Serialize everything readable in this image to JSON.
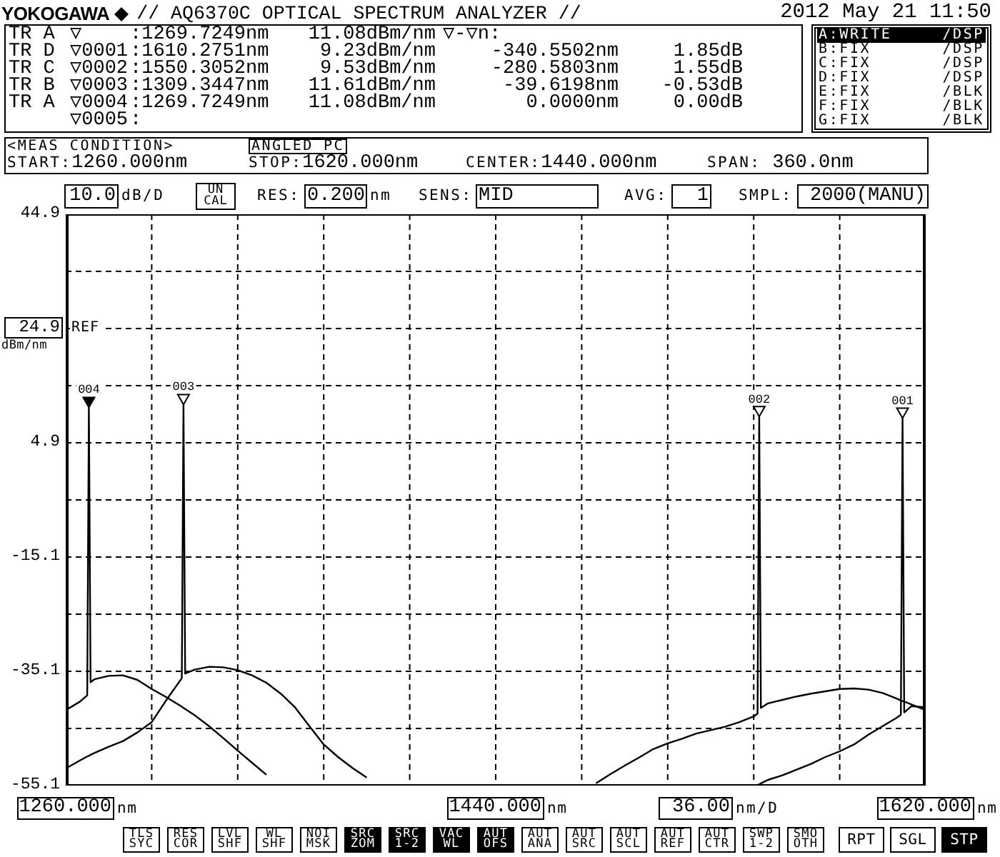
{
  "header": {
    "brand": "YOKOGAWA",
    "title": "// AQ6370C OPTICAL SPECTRUM ANALYZER //",
    "datetime": "2012 May 21 11:50"
  },
  "marker_table": {
    "active": {
      "trace": "TR A",
      "marker": "▽",
      "wavelength": ":1269.7249nm",
      "level": "11.08dBm/nm"
    },
    "delta_header": "▽-▽n:",
    "rows": [
      {
        "trace": "TR D",
        "marker": "▽0001",
        "wavelength": ":1610.2751nm",
        "level": "9.23dBm/nm",
        "delta_wavelength": "-340.5502nm",
        "delta_level": "1.85dB"
      },
      {
        "trace": "TR C",
        "marker": "▽0002",
        "wavelength": ":1550.3052nm",
        "level": "9.53dBm/nm",
        "delta_wavelength": "-280.5803nm",
        "delta_level": "1.55dB"
      },
      {
        "trace": "TR B",
        "marker": "▽0003",
        "wavelength": ":1309.3447nm",
        "level": "11.61dBm/nm",
        "delta_wavelength": "-39.6198nm",
        "delta_level": "-0.53dB"
      },
      {
        "trace": "TR A",
        "marker": "▽0004",
        "wavelength": ":1269.7249nm",
        "level": "11.08dBm/nm",
        "delta_wavelength": "0.0000nm",
        "delta_level": "0.00dB"
      },
      {
        "marker": "▽0005",
        "wavelength": ":"
      }
    ]
  },
  "traces": [
    {
      "label": "A:WRITE",
      "mode": "/DSP",
      "selected": true
    },
    {
      "label": "B:FIX",
      "mode": "/DSP",
      "selected": false
    },
    {
      "label": "C:FIX",
      "mode": "/DSP",
      "selected": false
    },
    {
      "label": "D:FIX",
      "mode": "/DSP",
      "selected": false
    },
    {
      "label": "E:FIX",
      "mode": "/BLK",
      "selected": false
    },
    {
      "label": "F:FIX",
      "mode": "/BLK",
      "selected": false
    },
    {
      "label": "G:FIX",
      "mode": "/BLK",
      "selected": false
    }
  ],
  "meas_condition": {
    "title": "<MEAS CONDITION>",
    "badge": "ANGLED PC",
    "fields": [
      {
        "label": "START:",
        "value": "1260.000nm"
      },
      {
        "label": "STOP:",
        "value": "1620.000nm"
      },
      {
        "label": "CENTER:",
        "value": "1440.000nm"
      },
      {
        "label": "SPAN:",
        "value": "360.0nm"
      }
    ]
  },
  "settings": [
    {
      "kind": "readout",
      "value": "10.0",
      "unit": "dB/D"
    },
    {
      "kind": "indicator",
      "lines": [
        "UN",
        "CAL"
      ]
    },
    {
      "kind": "readout",
      "label": "RES:",
      "value": "0.200",
      "unit": "nm"
    },
    {
      "kind": "select",
      "label": "SENS:",
      "value": "MID"
    },
    {
      "kind": "readout",
      "label": "AVG:",
      "value": "1"
    },
    {
      "kind": "readout",
      "label": "SMPL:",
      "value": "2000(MANU)"
    }
  ],
  "plot": {
    "ref": {
      "value": "24.9",
      "unit": "dBm/nm",
      "tag": "REF"
    },
    "markers": [
      {
        "label": "004",
        "selected": true
      },
      {
        "label": "003",
        "selected": false
      },
      {
        "label": "002",
        "selected": false
      },
      {
        "label": "001",
        "selected": false
      }
    ],
    "xtick_units": [
      "nm",
      "nm",
      "nm"
    ],
    "x_scale": {
      "value": "36.00",
      "unit": "nm/D"
    },
    "chart_data": {
      "type": "line",
      "grid": true,
      "xlim": [
        1260,
        1620
      ],
      "ylim": [
        -55.1,
        44.9
      ],
      "xticks": [
        {
          "value": 1260,
          "label": "1260.000"
        },
        {
          "value": 1440,
          "label": "1440.000"
        },
        {
          "value": 1620,
          "label": "1620.000"
        }
      ],
      "yticks": [
        {
          "value": 44.9,
          "label": "44.9"
        },
        {
          "value": 4.9,
          "label": "4.9"
        },
        {
          "value": -15.1,
          "label": "-15.1"
        },
        {
          "value": -35.1,
          "label": "-35.1"
        },
        {
          "value": -55.1,
          "label": "-55.1"
        }
      ],
      "x": [
        1260,
        1266,
        1269,
        1269.7,
        1270.4,
        1272,
        1278,
        1284,
        1290,
        1296,
        1302,
        1308.6,
        1309.3,
        1310,
        1314,
        1320,
        1326,
        1332,
        1338,
        1344,
        1350,
        1356,
        1362,
        1368,
        1374,
        1380,
        1386,
        1482,
        1488,
        1494,
        1500,
        1506,
        1512,
        1518,
        1524,
        1530,
        1536,
        1542,
        1548,
        1549.6,
        1550.3,
        1551,
        1554,
        1560,
        1566,
        1572,
        1578,
        1584,
        1590,
        1596,
        1602,
        1608,
        1609.6,
        1610.3,
        1611,
        1614,
        1620
      ],
      "series": [
        {
          "color": "#000000",
          "values": [
            -41.9,
            -40.4,
            -39.3,
            11.1,
            -37.0,
            -36.5,
            -35.9,
            -35.8,
            -36.6,
            -38.2,
            -39.6,
            -41.3,
            -41.5,
            -41.7,
            -42.8,
            -44.7,
            -46.8,
            -49.0,
            -51.1,
            -53.2,
            null,
            null,
            null,
            null,
            null,
            null,
            null,
            null,
            null,
            null,
            null,
            null,
            null,
            null,
            null,
            null,
            null,
            null,
            null,
            null,
            null,
            null,
            null,
            null,
            null,
            null,
            null,
            null,
            null,
            null,
            null,
            null,
            null,
            null,
            null,
            null,
            null
          ]
        },
        {
          "color": "#000000",
          "values": [
            -52.1,
            -50.7,
            -50.0,
            -49.9,
            -49.7,
            -49.4,
            -48.3,
            -47.3,
            -45.8,
            -44.0,
            -40.2,
            -36.3,
            11.6,
            -35.5,
            -34.8,
            -34.3,
            -34.4,
            -34.9,
            -35.8,
            -37.1,
            -39.0,
            -41.4,
            -44.7,
            -47.9,
            -50.1,
            -52.0,
            -53.7,
            null,
            null,
            null,
            null,
            null,
            null,
            null,
            null,
            null,
            null,
            null,
            null,
            null,
            null,
            null,
            null,
            null,
            null,
            null,
            null,
            null,
            null,
            null,
            null,
            null,
            null,
            null,
            null,
            null,
            null
          ]
        },
        {
          "color": "#000000",
          "values": [
            null,
            null,
            null,
            null,
            null,
            null,
            null,
            null,
            null,
            null,
            null,
            null,
            null,
            null,
            null,
            null,
            null,
            null,
            null,
            null,
            null,
            null,
            null,
            null,
            null,
            null,
            null,
            -54.7,
            -53.1,
            -51.6,
            -50.2,
            -48.7,
            -47.7,
            -46.9,
            -46.0,
            -45.4,
            -44.8,
            -44.0,
            -43.0,
            -42.5,
            9.5,
            -41.5,
            -40.7,
            -40.1,
            -39.5,
            -39.0,
            -38.6,
            -38.2,
            -38.1,
            -38.3,
            -38.9,
            -39.9,
            -40.2,
            -40.3,
            -40.4,
            -40.9,
            -41.9
          ]
        },
        {
          "color": "#000000",
          "values": [
            null,
            null,
            null,
            null,
            null,
            null,
            null,
            null,
            null,
            null,
            null,
            null,
            null,
            null,
            null,
            null,
            null,
            null,
            null,
            null,
            null,
            null,
            null,
            null,
            null,
            null,
            null,
            null,
            null,
            null,
            null,
            null,
            null,
            null,
            null,
            null,
            null,
            null,
            null,
            -55.0,
            -54.9,
            -54.7,
            -54.1,
            -53.3,
            -52.3,
            -51.3,
            -50.1,
            -49.1,
            -47.9,
            -46.2,
            -44.7,
            -43.2,
            -42.7,
            9.2,
            -42.3,
            -41.2,
            -41.4
          ]
        }
      ]
    }
  },
  "soft_keys": [
    {
      "lines": [
        "TLS",
        "SYC"
      ],
      "on": false
    },
    {
      "lines": [
        "RES",
        "COR"
      ],
      "on": false
    },
    {
      "lines": [
        "LVL",
        "SHF"
      ],
      "on": false
    },
    {
      "lines": [
        "WL",
        "SHF"
      ],
      "on": false
    },
    {
      "lines": [
        "NOI",
        "MSK"
      ],
      "on": false
    },
    {
      "lines": [
        "SRC",
        "ZOM"
      ],
      "on": true
    },
    {
      "lines": [
        "SRC",
        "1-2"
      ],
      "on": true
    },
    {
      "lines": [
        "VAC",
        "WL"
      ],
      "on": true
    },
    {
      "lines": [
        "AUT",
        "OFS"
      ],
      "on": true
    },
    {
      "lines": [
        "AUT",
        "ANA"
      ],
      "on": false
    },
    {
      "lines": [
        "AUT",
        "SRC"
      ],
      "on": false
    },
    {
      "lines": [
        "AUT",
        "SCL"
      ],
      "on": false
    },
    {
      "lines": [
        "AUT",
        "REF"
      ],
      "on": false
    },
    {
      "lines": [
        "AUT",
        "CTR"
      ],
      "on": false
    },
    {
      "lines": [
        "SWP",
        "1-2"
      ],
      "on": false
    },
    {
      "lines": [
        "SMO",
        "OTH"
      ],
      "on": false
    }
  ],
  "side_keys": [
    {
      "label": "RPT",
      "on": false
    },
    {
      "label": "SGL",
      "on": false
    },
    {
      "label": "STP",
      "on": true
    }
  ]
}
